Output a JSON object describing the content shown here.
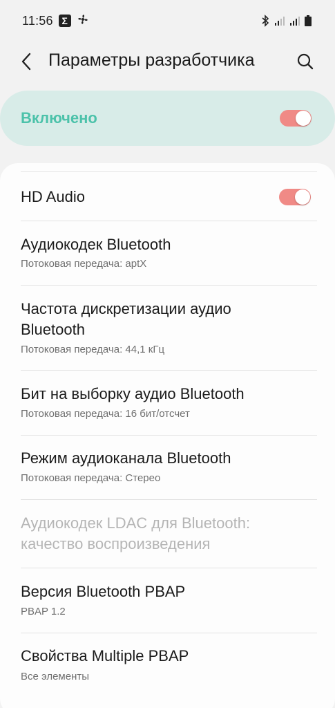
{
  "status_bar": {
    "time": "11:56",
    "icons": [
      "sigma-badge",
      "fan-icon",
      "bluetooth-icon",
      "signal-icon",
      "signal-icon",
      "battery-icon"
    ]
  },
  "app_bar": {
    "title": "Параметры разработчика",
    "back_icon": "chevron-left-icon",
    "search_icon": "search-icon"
  },
  "master_switch": {
    "label": "Включено",
    "enabled": true,
    "accent_color": "#4cc2aa",
    "toggle_color": "#f08a86"
  },
  "settings": {
    "hd_audio": {
      "title": "HD Audio",
      "enabled": true
    },
    "bt_codec": {
      "title": "Аудиокодек Bluetooth",
      "summary": "Потоковая передача: aptX"
    },
    "bt_sample_rate": {
      "title_line1": "Частота дискретизации аудио",
      "title_line2": "Bluetooth",
      "summary": "Потоковая передача: 44,1 кГц"
    },
    "bt_bits": {
      "title": "Бит на выборку аудио Bluetooth",
      "summary": "Потоковая передача: 16 бит/отсчет"
    },
    "bt_channel": {
      "title": "Режим аудиоканала Bluetooth",
      "summary": "Потоковая передача: Стерео"
    },
    "ldac_quality": {
      "title_line1": "Аудиокодек LDAC для Bluetooth:",
      "title_line2": "качество воспроизведения",
      "disabled": true
    },
    "pbap_version": {
      "title": "Версия Bluetooth PBAP",
      "summary": "PBAP 1.2"
    },
    "multiple_pbap": {
      "title": "Свойства Multiple PBAP",
      "summary": "Все элементы"
    }
  }
}
